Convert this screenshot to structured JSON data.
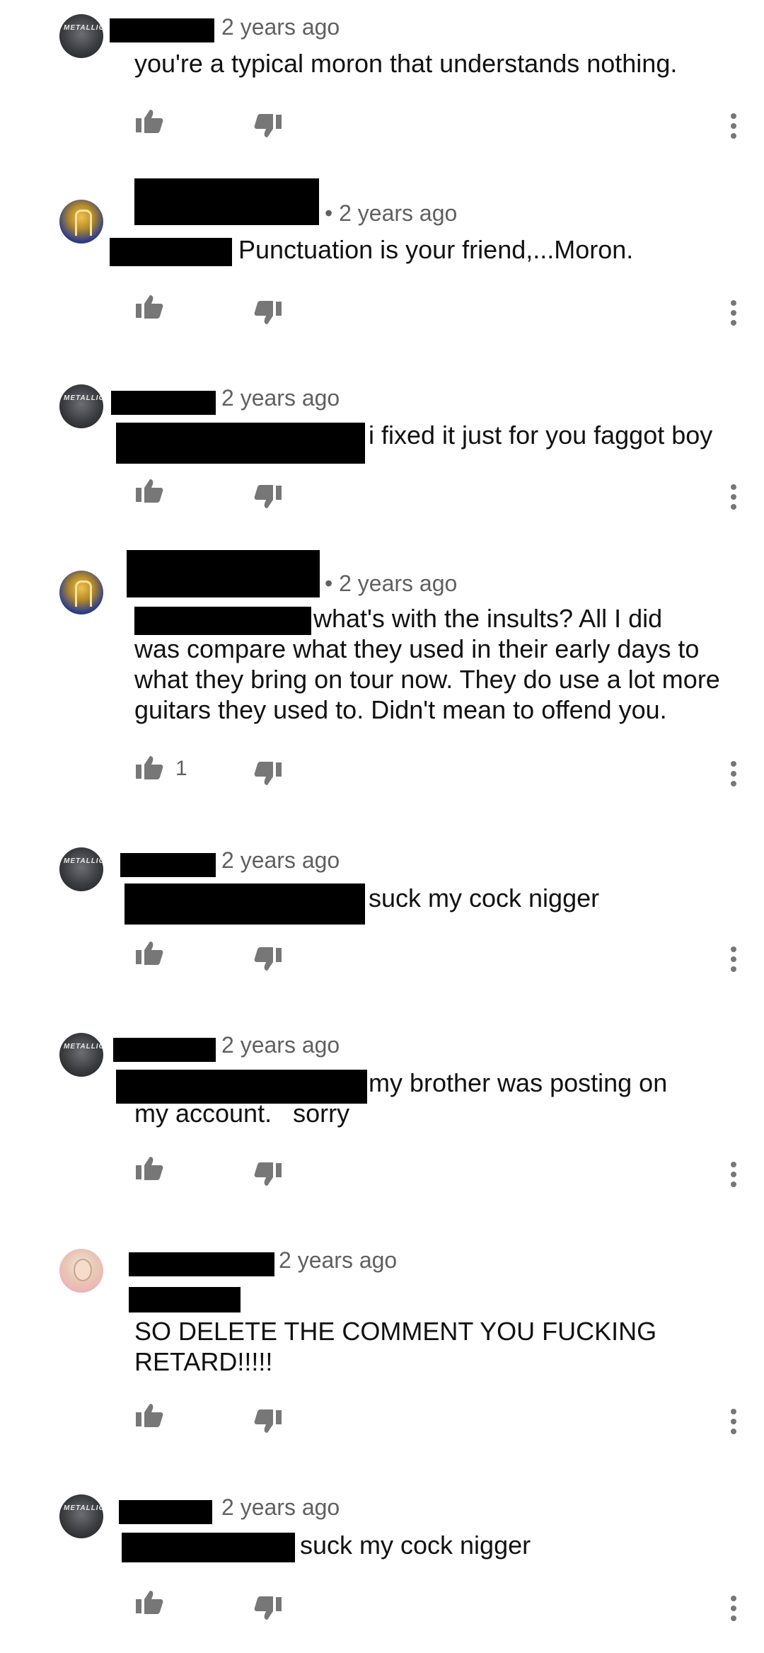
{
  "comments": [
    {
      "author_redacted": true,
      "time": "2 years ago",
      "text": "you're a typical moron that understands nothing.",
      "likes": ""
    },
    {
      "author_redacted": true,
      "time": "• 2 years ago",
      "text": "Punctuation is your friend,...Moron.",
      "likes": ""
    },
    {
      "author_redacted": true,
      "time": "2 years ago",
      "text": "i fixed it just for you faggot boy",
      "likes": ""
    },
    {
      "author_redacted": true,
      "time": "• 2 years ago",
      "text": "what's with the insults? All I did",
      "text2": "was compare what they used in their early days to what they bring on tour now. They do use a lot more guitars they used to. Didn't mean to offend you.",
      "likes": "1"
    },
    {
      "author_redacted": true,
      "time": "2 years ago",
      "text": "suck my cock nigger",
      "likes": ""
    },
    {
      "author_redacted": true,
      "time": "2 years ago",
      "text": "my brother was posting on",
      "text2": "my account.   sorry",
      "likes": ""
    },
    {
      "author_redacted": true,
      "time": "2 years ago",
      "text": "SO DELETE THE COMMENT YOU FUCKING RETARD!!!!!",
      "likes": ""
    },
    {
      "author_redacted": true,
      "time": "2 years ago",
      "text": "suck my cock nigger",
      "likes": ""
    }
  ],
  "avatar_logo_text": "METALLICA",
  "icons": {
    "like": "thumbs-up-icon",
    "dislike": "thumbs-down-icon",
    "more": "more-vertical-icon"
  },
  "colors": {
    "meta": "#606060",
    "icon": "#777777",
    "redaction": "#000000"
  }
}
